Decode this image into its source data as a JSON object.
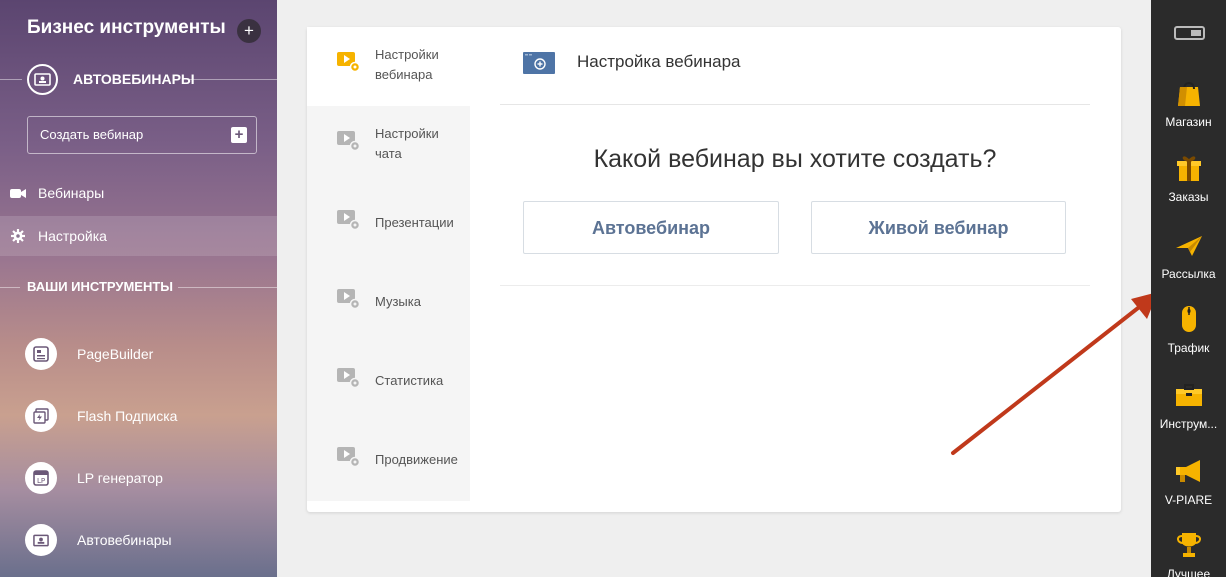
{
  "sidebar": {
    "title": "Бизнес инструменты",
    "add_label": "+",
    "section_autowebinars": "АВТОВЕБИНАРЫ",
    "create_button": "Создать вебинар",
    "nav": [
      {
        "label": "Вебинары",
        "icon": "video-camera-icon"
      },
      {
        "label": "Настройка",
        "icon": "gear-icon"
      }
    ],
    "section_tools": "ВАШИ ИНСТРУМЕНТЫ",
    "tools": [
      {
        "label": "PageBuilder",
        "icon": "pagebuilder-icon"
      },
      {
        "label": "Flash Подписка",
        "icon": "flash-subscription-icon"
      },
      {
        "label": "LP генератор",
        "icon": "lp-generator-icon"
      },
      {
        "label": "Автовебинары",
        "icon": "autowebinar-icon"
      }
    ]
  },
  "submenu": [
    {
      "label": "Настройки вебинара",
      "active": true
    },
    {
      "label": "Настройки чата",
      "active": false
    },
    {
      "label": "Презентации",
      "active": false
    },
    {
      "label": "Музыка",
      "active": false
    },
    {
      "label": "Статистика",
      "active": false
    },
    {
      "label": "Продвижение",
      "active": false
    }
  ],
  "content": {
    "header_title": "Настройка вебинара",
    "question": "Какой вебинар вы хотите создать?",
    "choice_auto": "Автовебинар",
    "choice_live": "Живой вебинар"
  },
  "dock": {
    "items": [
      {
        "label": "Магазин",
        "icon": "shopping-bag-icon"
      },
      {
        "label": "Заказы",
        "icon": "gift-box-icon"
      },
      {
        "label": "Рассылка",
        "icon": "paper-plane-icon"
      },
      {
        "label": "Трафик",
        "icon": "mouse-icon"
      },
      {
        "label": "Инструм...",
        "icon": "toolbox-icon"
      },
      {
        "label": "V-PIARE",
        "icon": "megaphone-icon"
      },
      {
        "label": "Лучшее",
        "icon": "trophy-icon"
      }
    ]
  },
  "colors": {
    "accent_text": "#5c7394",
    "arrow": "#c0391b",
    "icon_yellow": "#f6b300",
    "dock_bg": "#2b2b2b"
  }
}
